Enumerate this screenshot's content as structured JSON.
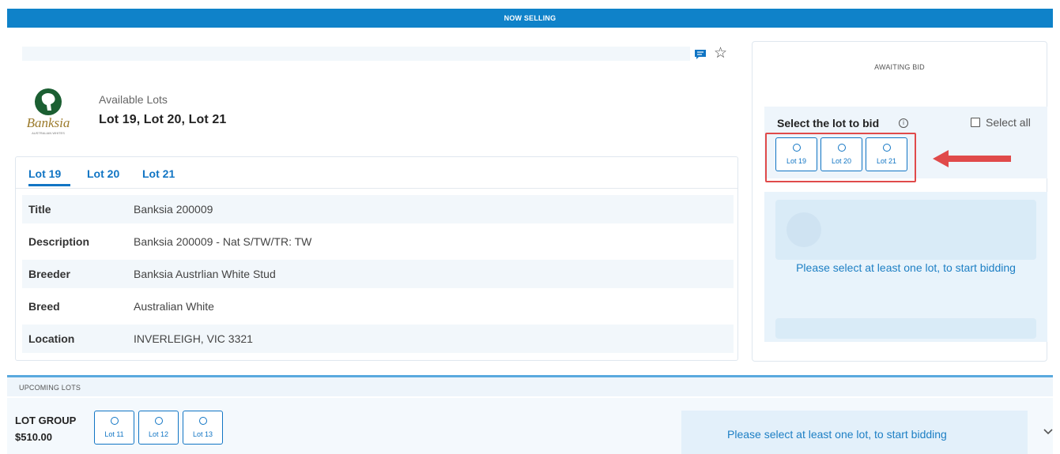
{
  "header": {
    "banner": "NOW SELLING"
  },
  "sale": {
    "logo_text": "Banksia",
    "logo_subtext": "AUSTRALIAN WHITES",
    "available_label": "Available Lots",
    "available_lots": "Lot 19,  Lot 20,  Lot 21"
  },
  "tabs": [
    {
      "label": "Lot 19",
      "active": true
    },
    {
      "label": "Lot 20",
      "active": false
    },
    {
      "label": "Lot 21",
      "active": false
    }
  ],
  "details": [
    {
      "key": "Title",
      "value": "Banksia 200009"
    },
    {
      "key": "Description",
      "value": "Banksia 200009 - Nat S/TW/TR: TW"
    },
    {
      "key": "Breeder",
      "value": "Banksia Austrlian White Stud"
    },
    {
      "key": "Breed",
      "value": "Australian White"
    },
    {
      "key": "Location",
      "value": "INVERLEIGH, VIC 3321"
    }
  ],
  "bid_panel": {
    "status": "AWAITING BID",
    "select_title": "Select the lot to bid",
    "select_all": "Select all",
    "lots": [
      "Lot 19",
      "Lot 20",
      "Lot 21"
    ],
    "message": "Please select at least one lot, to start bidding"
  },
  "upcoming": {
    "label": "UPCOMING LOTS",
    "group_label": "LOT GROUP",
    "group_price": "$510.00",
    "lots": [
      "Lot 11",
      "Lot 12",
      "Lot 13"
    ],
    "message": "Please select at least one lot, to start bidding"
  },
  "colors": {
    "primary": "#0f82c9",
    "highlight": "#e04a4a",
    "link": "#1175c4"
  },
  "icons": [
    "chat-icon",
    "star-icon",
    "info-icon",
    "lot-radio-icon",
    "red-arrow-icon",
    "chevron-down-icon"
  ]
}
